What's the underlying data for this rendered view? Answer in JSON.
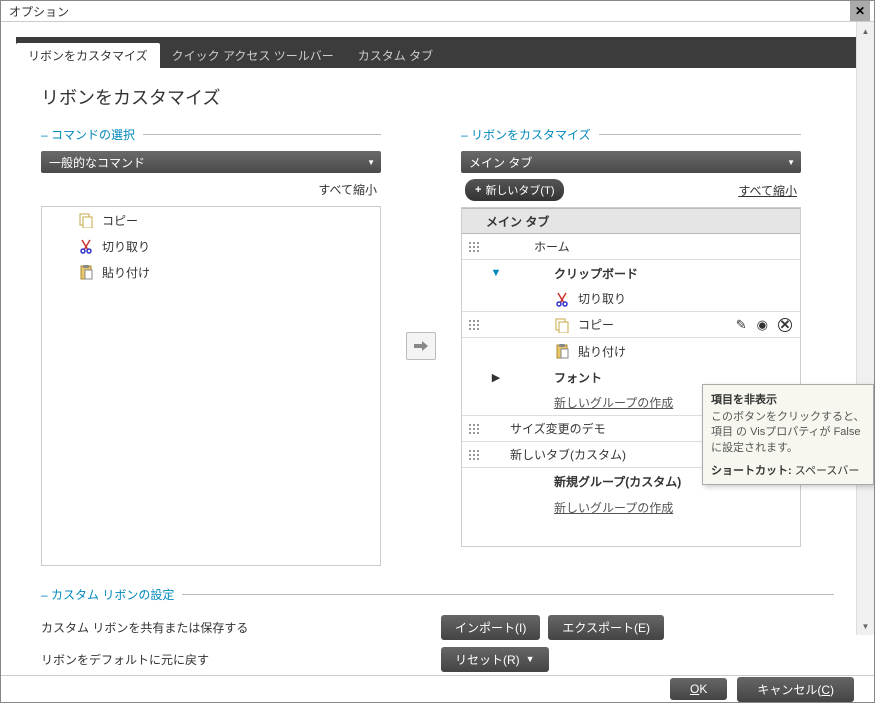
{
  "window": {
    "title": "オプション"
  },
  "tabs": {
    "customize_ribbon": "リボンをカスタマイズ",
    "quick_access": "クイック アクセス ツールバー",
    "custom_tab": "カスタム タブ"
  },
  "page_title": "リボンをカスタマイズ",
  "left": {
    "section": "コマンドの選択",
    "dropdown": "一般的なコマンド",
    "collapse": "すべて縮小",
    "items": {
      "copy": "コピー",
      "cut": "切り取り",
      "paste": "貼り付け"
    }
  },
  "right": {
    "section": "リボンをカスタマイズ",
    "dropdown": "メイン タブ",
    "new_tab_btn": "新しいタブ(T)",
    "collapse": "すべて縮小",
    "group_header": "メイン タブ",
    "nodes": {
      "home": "ホーム",
      "clipboard": "クリップボード",
      "cut": "切り取り",
      "copy": "コピー",
      "paste": "貼り付け",
      "font": "フォント",
      "new_group_link": "新しいグループの作成",
      "resize_demo": "サイズ変更のデモ",
      "new_tab_custom": "新しいタブ(カスタム)",
      "new_group_custom": "新規グループ(カスタム)"
    }
  },
  "settings": {
    "section": "カスタム リボンの設定",
    "share_label": "カスタム リボンを共有または保存する",
    "import_btn": "インポート(I)",
    "export_btn": "エクスポート(E)",
    "reset_label": "リボンをデフォルトに元に戻す",
    "reset_btn": "リセット(R)"
  },
  "footer": {
    "ok": "OK",
    "cancel_pre": "キャンセル(",
    "cancel_key": "C",
    "cancel_post": ")"
  },
  "tooltip": {
    "title": "項目を非表示",
    "body": "このボタンをクリックすると、項目 の Visプロパティが False に設定されます。",
    "shortcut_label": "ショートカット:",
    "shortcut_value": "スペースバー"
  }
}
